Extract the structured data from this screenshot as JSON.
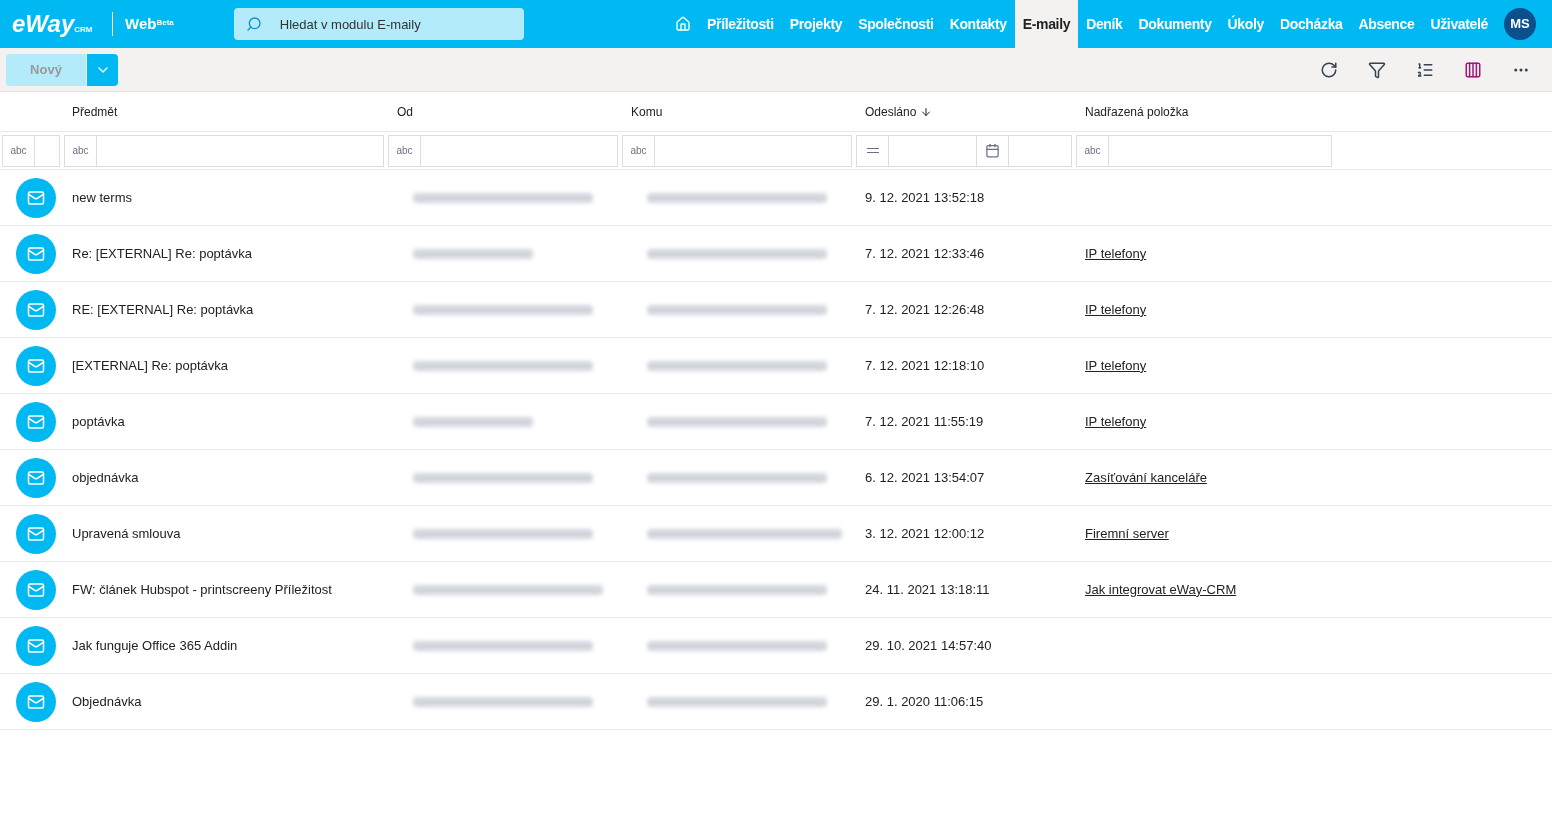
{
  "header": {
    "logo": "eWay",
    "logo_sub": "CRM",
    "product": "Web",
    "product_tag": "Beta",
    "search": {
      "placeholder": "Hledat v modulu E-maily"
    },
    "nav": [
      {
        "label": "Příležitosti",
        "selected": false
      },
      {
        "label": "Projekty",
        "selected": false
      },
      {
        "label": "Společnosti",
        "selected": false
      },
      {
        "label": "Kontakty",
        "selected": false
      },
      {
        "label": "E-maily",
        "selected": true
      },
      {
        "label": "Deník",
        "selected": false
      },
      {
        "label": "Dokumenty",
        "selected": false
      },
      {
        "label": "Úkoly",
        "selected": false
      },
      {
        "label": "Docházka",
        "selected": false
      },
      {
        "label": "Absence",
        "selected": false
      },
      {
        "label": "Uživatelé",
        "selected": false
      }
    ],
    "avatar": "MS"
  },
  "toolbar": {
    "new_button": {
      "label": "Nový",
      "disabled": true
    }
  },
  "table": {
    "columns": [
      {
        "label": "Předmět",
        "sorted": false,
        "kind": "text",
        "filter_icon": "abc"
      },
      {
        "label": "Od",
        "sorted": false,
        "kind": "text",
        "filter_icon": "abc"
      },
      {
        "label": "Komu",
        "sorted": false,
        "kind": "text",
        "filter_icon": "abc"
      },
      {
        "label": "Odesláno",
        "sorted": true,
        "kind": "date"
      },
      {
        "label": "Nadřazená položka",
        "sorted": false,
        "kind": "text",
        "filter_icon": "abc"
      }
    ],
    "leading_filter": "abc",
    "rows": [
      {
        "subject": "new terms",
        "sent": "9. 12. 2021 13:52:18"
      },
      {
        "subject": "Re: [EXTERNAL] Re: poptávka",
        "sent": "7. 12. 2021 12:33:46",
        "parent": "IP telefony"
      },
      {
        "subject": "RE: [EXTERNAL] Re: poptávka",
        "sent": "7. 12. 2021 12:26:48",
        "parent": "IP telefony"
      },
      {
        "subject": "[EXTERNAL] Re: poptávka",
        "sent": "7. 12. 2021 12:18:10",
        "parent": "IP telefony"
      },
      {
        "subject": "poptávka",
        "sent": "7. 12. 2021 11:55:19",
        "parent": "IP telefony"
      },
      {
        "subject": "objednávka",
        "sent": "6. 12. 2021 13:54:07",
        "parent": "Zasíťování kanceláře"
      },
      {
        "subject": "Upravená smlouva",
        "sent": "3. 12. 2021 12:00:12",
        "parent": "Firemní server"
      },
      {
        "subject": "FW: článek Hubspot - printscreeny Příležitost",
        "sent": "24. 11. 2021 13:18:11",
        "parent": "Jak integrovat eWay-CRM"
      },
      {
        "subject": "Jak funguje Office 365 Addin",
        "sent": "29. 10. 2021 14:57:40"
      },
      {
        "subject": "Objednávka",
        "sent": "29. 1. 2020 11:06:15"
      }
    ]
  }
}
